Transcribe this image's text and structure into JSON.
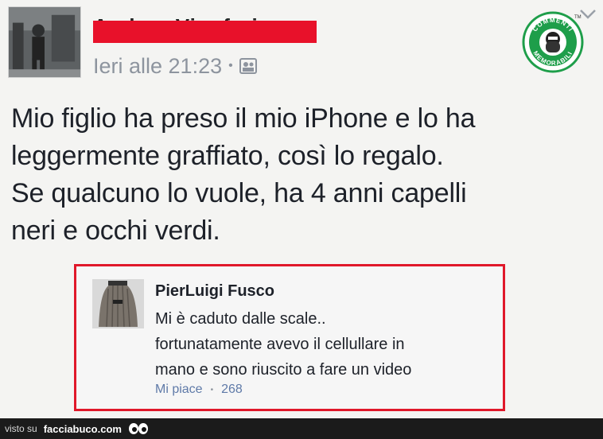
{
  "post": {
    "author_name": "Andrea Vin. fari",
    "timestamp": "Ieri alle 21:23",
    "separator": "•",
    "audience_icon": "friends-icon",
    "text_lines": [
      "Mio figlio ha preso il mio iPhone e lo ha",
      "leggermente graffiato, così lo regalo.",
      "Se qualcuno lo vuole, ha 4 anni capelli",
      "neri e occhi verdi."
    ]
  },
  "badge": {
    "top_text": "COMMENTI",
    "bottom_text": "MEMORABILI",
    "tm": "TM",
    "color": "#1e9e4a"
  },
  "comment": {
    "author": "PierLuigi Fusco",
    "text_lines": [
      "Mi è caduto dalle scale..",
      "fortunatamente avevo il cellullare in",
      "mano e sono riuscito a fare un video"
    ],
    "like_label": "Mi piace",
    "separator": "•",
    "like_count": "268",
    "highlight_color": "#e0182a"
  },
  "footer": {
    "via_label": "visto su",
    "site": "facciabuco.com"
  },
  "colors": {
    "redaction": "#e8112a",
    "meta_gray": "#8d949e",
    "link_blue": "#5f7aa8"
  }
}
